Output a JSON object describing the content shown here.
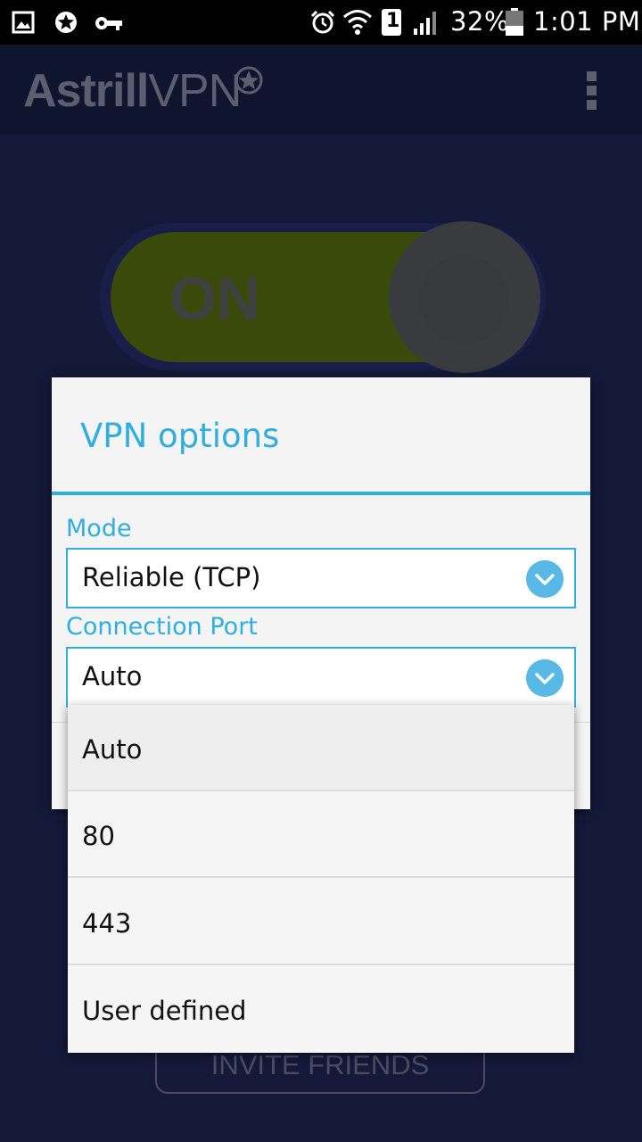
{
  "status_bar": {
    "time": "1:01 PM",
    "battery_percent": "32%",
    "sim_slot": "1",
    "icons": [
      "gallery-icon",
      "astrill-star-icon",
      "vpn-key-icon",
      "alarm-icon",
      "wifi-icon",
      "sim-icon",
      "signal-icon",
      "battery-icon"
    ]
  },
  "app_bar": {
    "logo_bold": "Astrill",
    "logo_light": "VPN",
    "menu_icon": "overflow-menu-icon"
  },
  "toggle": {
    "label": "ON",
    "state": "on",
    "color": "#7aa61a"
  },
  "invite_button": {
    "label": "INVITE FRIENDS"
  },
  "dialog": {
    "title": "VPN options",
    "accent_color": "#2faee0",
    "mode": {
      "label": "Mode",
      "value": "Reliable (TCP)"
    },
    "port": {
      "label": "Connection Port",
      "value": "Auto"
    }
  },
  "dropdown": {
    "options": [
      "Auto",
      "80",
      "443",
      "User defined"
    ]
  }
}
